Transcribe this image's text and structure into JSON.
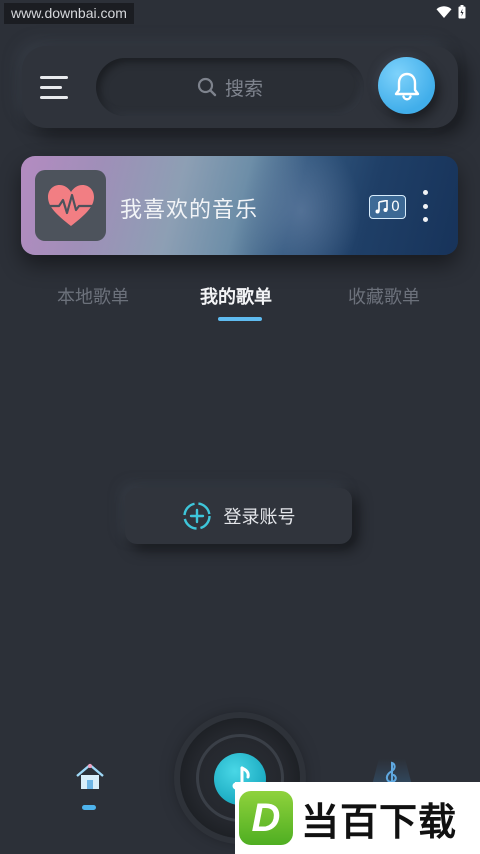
{
  "status_bar": {
    "watermark": "www.downbai.com"
  },
  "header": {
    "search_placeholder": "搜索"
  },
  "favorite_card": {
    "title": "我喜欢的音乐",
    "song_count": "0"
  },
  "tabs": [
    {
      "label": "本地歌单",
      "active": false
    },
    {
      "label": "我的歌单",
      "active": true
    },
    {
      "label": "收藏歌单",
      "active": false
    }
  ],
  "login": {
    "label": "登录账号"
  },
  "watermark_logo": {
    "mark": "D",
    "text": "当百下载"
  },
  "colors": {
    "accent": "#41aeea",
    "background": "#2c3038",
    "music_center": "#19a9c0"
  }
}
